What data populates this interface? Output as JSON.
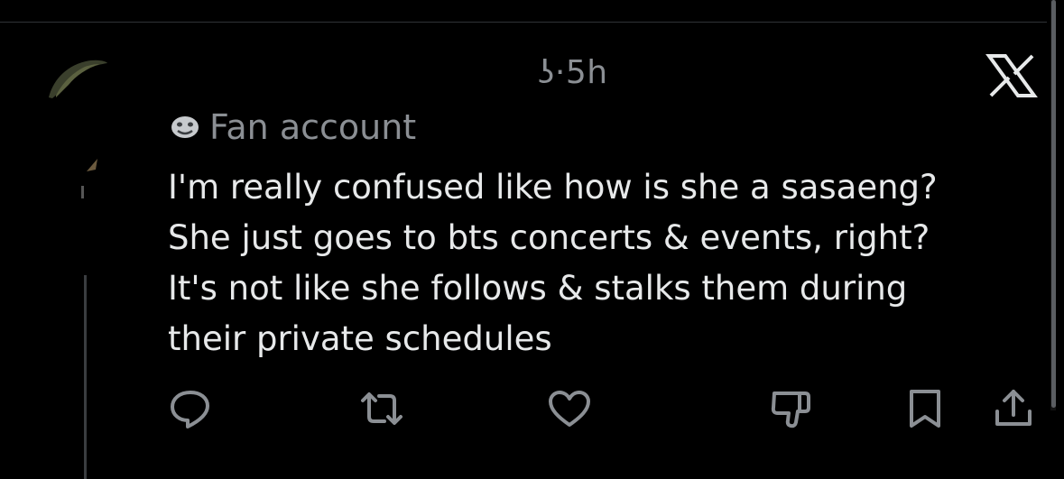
{
  "header": {
    "meta": "ʖ·5h",
    "logo": "x-logo-icon"
  },
  "tweet": {
    "author_name": "Fan account",
    "lines": [
      "I'm really confused like how is she a sasaeng?",
      "She just goes to bts concerts & events, right?",
      "It's not like she follows & stalks them during",
      "their private schedules"
    ]
  },
  "actions": [
    {
      "icon": "reply-icon"
    },
    {
      "icon": "retweet-icon"
    },
    {
      "icon": "like-icon"
    },
    {
      "icon": "dislike-icon"
    },
    {
      "icon": "bookmark-icon"
    },
    {
      "icon": "share-icon"
    }
  ],
  "colors": {
    "background": "#000000",
    "text_primary": "#e7e9ea",
    "text_secondary": "#8b8f94",
    "icon": "#8b8f94"
  }
}
